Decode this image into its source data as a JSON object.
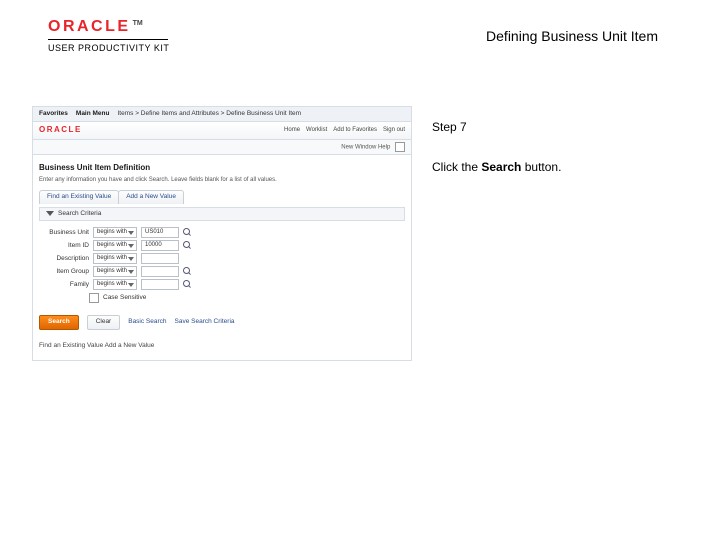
{
  "header": {
    "brand": "ORACLE",
    "tm": "TM",
    "product": "USER PRODUCTIVITY KIT",
    "page_title": "Defining Business Unit Item"
  },
  "right": {
    "step_label": "Step 7",
    "instruction_prefix": "Click the ",
    "instruction_bold": "Search",
    "instruction_suffix": " button."
  },
  "shot": {
    "topbar": {
      "item1": "Favorites",
      "item2": "Main Menu",
      "crumb": "Items  >  Define Items and Attributes  >  Define Business Unit Item"
    },
    "brandbar": {
      "logo": "ORACLE",
      "right1": "Home",
      "right2": "Worklist",
      "right3": "Add to Favorites",
      "right4": "Sign out"
    },
    "subbar": {
      "label": "New Window   Help"
    },
    "page_heading": "Business Unit Item Definition",
    "page_desc": "Enter any information you have and click Search. Leave fields blank for a list of all values.",
    "tabs": {
      "t1": "Find an Existing Value",
      "t2": "Add a New Value"
    },
    "criteria_label": "Search Criteria",
    "form": {
      "r1": {
        "label": "Business Unit",
        "op": "begins with",
        "val": "US010"
      },
      "r2": {
        "label": "Item ID",
        "op": "begins with",
        "val": "10000"
      },
      "r3": {
        "label": "Description",
        "op": "begins with",
        "val": ""
      },
      "r4": {
        "label": "Item Group",
        "op": "begins with",
        "val": ""
      },
      "r5": {
        "label": "Family",
        "op": "begins with",
        "val": ""
      }
    },
    "case_label": "Case Sensitive",
    "buttons": {
      "search": "Search",
      "clear": "Clear",
      "basic": "Basic Search",
      "save": "Save Search Criteria"
    },
    "footer_link": "Find an Existing Value   Add a New Value"
  }
}
